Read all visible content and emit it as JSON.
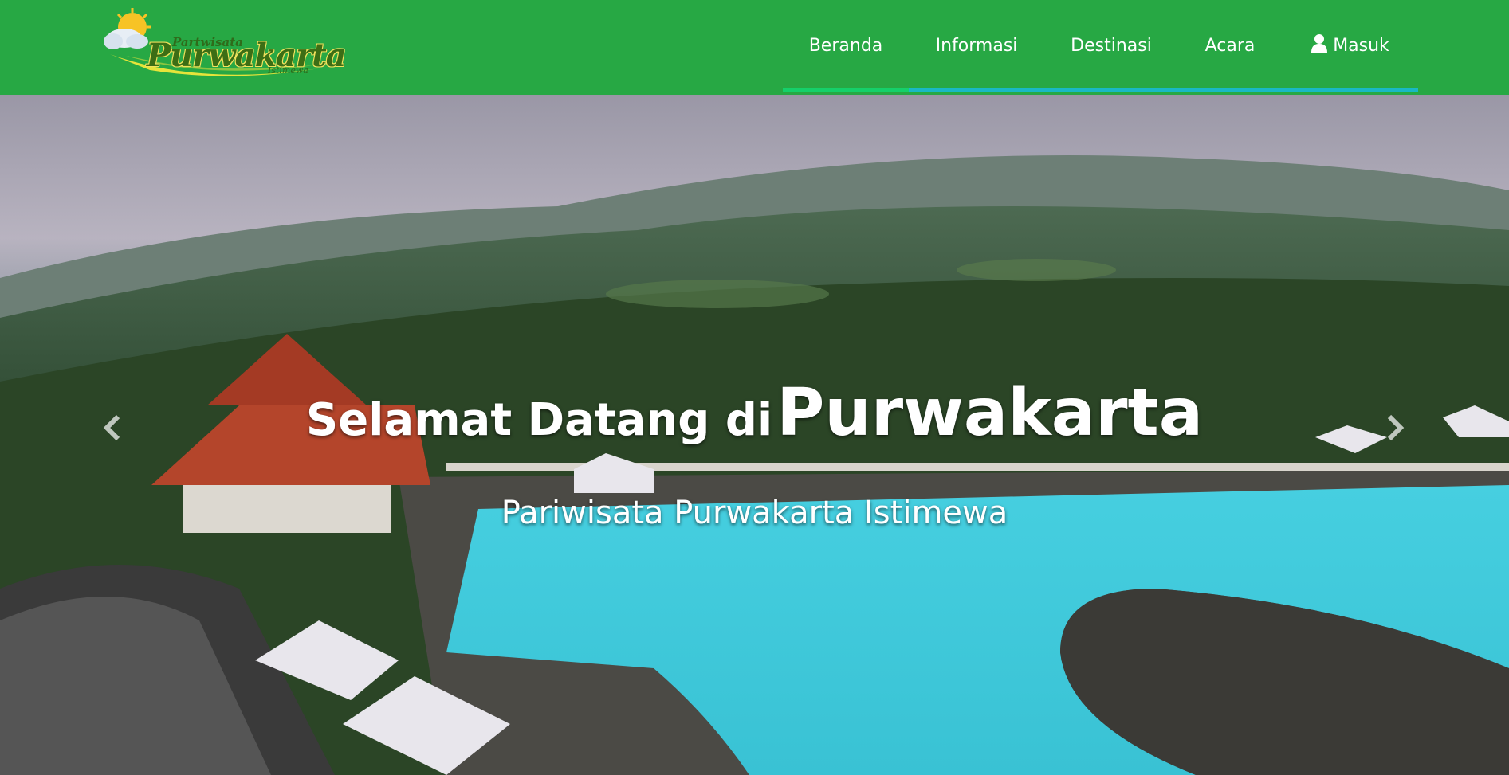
{
  "logo": {
    "top_text": "Partwisata",
    "main_text": "Purwakarta",
    "sub_text": "Istimewa"
  },
  "nav": {
    "items": [
      {
        "label": "Beranda",
        "active": true
      },
      {
        "label": "Informasi"
      },
      {
        "label": "Destinasi"
      },
      {
        "label": "Acara"
      },
      {
        "label": "Masuk",
        "icon": "user-icon"
      }
    ]
  },
  "hero": {
    "title_lead": "Selamat Datang di",
    "title_main": "Purwakarta",
    "subtitle": "Pariwisata Purwakarta Istimewa",
    "prev_icon": "chevron-left-icon",
    "next_icon": "chevron-right-icon"
  },
  "colors": {
    "navbar": "#27a844",
    "nav_underline": "#19b8c4",
    "nav_active": "#15d06a",
    "pool": "#3cc7d6"
  }
}
